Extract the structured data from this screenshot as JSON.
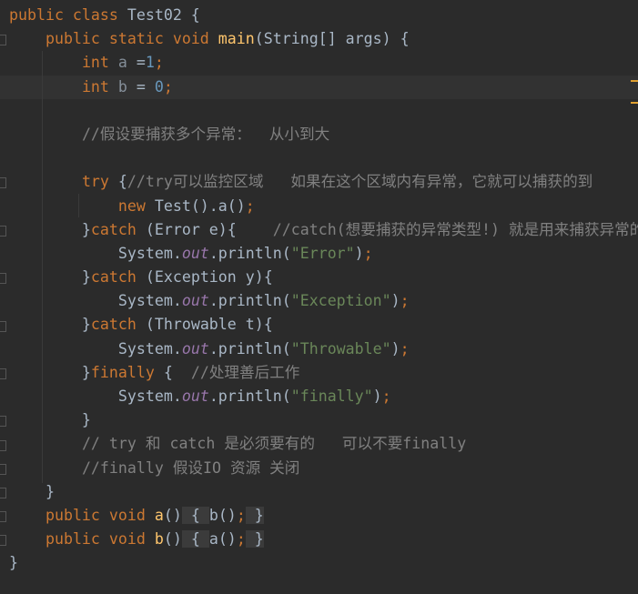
{
  "editor": {
    "current_line": 3,
    "colors": {
      "background": "#2b2b2b",
      "keyword": "#cc7832",
      "number": "#6897bb",
      "string": "#6a8759",
      "comment": "#808080",
      "method": "#ffc66d",
      "field": "#9876aa",
      "text": "#a9b7c6"
    },
    "lines": [
      {
        "tokens": [
          [
            "kw",
            "public class "
          ],
          [
            "",
            "Test02 {"
          ]
        ]
      },
      {
        "tokens": [
          [
            "",
            "    "
          ],
          [
            "kw",
            "public static void "
          ],
          [
            "fn",
            "main"
          ],
          [
            "",
            "(String[] args) {"
          ]
        ]
      },
      {
        "tokens": [
          [
            "",
            "        "
          ],
          [
            "kw",
            "int "
          ],
          [
            "var",
            "a "
          ],
          [
            "",
            "="
          ],
          [
            "num",
            "1"
          ],
          [
            "kw",
            ";"
          ]
        ]
      },
      {
        "tokens": [
          [
            "",
            "        "
          ],
          [
            "kw",
            "int "
          ],
          [
            "var",
            "b "
          ],
          [
            "",
            "= "
          ],
          [
            "num",
            "0"
          ],
          [
            "kw",
            ";"
          ]
        ]
      },
      {
        "tokens": []
      },
      {
        "tokens": [
          [
            "",
            "        "
          ],
          [
            "cm",
            "//假设要捕获多个异常：  从小到大"
          ]
        ]
      },
      {
        "tokens": []
      },
      {
        "tokens": [
          [
            "",
            "        "
          ],
          [
            "kw",
            "try "
          ],
          [
            "",
            "{"
          ],
          [
            "cm",
            "//try可以监控区域   如果在这个区域内有异常，它就可以捕获的到"
          ]
        ]
      },
      {
        "tokens": [
          [
            "",
            "            "
          ],
          [
            "kw",
            "new "
          ],
          [
            "",
            "Test().a()"
          ],
          [
            "kw",
            ";"
          ]
        ]
      },
      {
        "tokens": [
          [
            "",
            "        }"
          ],
          [
            "kw",
            "catch "
          ],
          [
            "",
            "(Error e){    "
          ],
          [
            "cm",
            "//catch(想要捕获的异常类型!) 就是用来捕获异常的"
          ]
        ]
      },
      {
        "tokens": [
          [
            "",
            "            System."
          ],
          [
            "fld",
            "out"
          ],
          [
            "",
            ".println("
          ],
          [
            "str",
            "\"Error\""
          ],
          [
            "",
            ")"
          ],
          [
            "kw",
            ";"
          ]
        ]
      },
      {
        "tokens": [
          [
            "",
            "        }"
          ],
          [
            "kw",
            "catch "
          ],
          [
            "",
            "(Exception y){"
          ]
        ]
      },
      {
        "tokens": [
          [
            "",
            "            System."
          ],
          [
            "fld",
            "out"
          ],
          [
            "",
            ".println("
          ],
          [
            "str",
            "\"Exception\""
          ],
          [
            "",
            ")"
          ],
          [
            "kw",
            ";"
          ]
        ]
      },
      {
        "tokens": [
          [
            "",
            "        }"
          ],
          [
            "kw",
            "catch "
          ],
          [
            "",
            "(Throwable t){"
          ]
        ]
      },
      {
        "tokens": [
          [
            "",
            "            System."
          ],
          [
            "fld",
            "out"
          ],
          [
            "",
            ".println("
          ],
          [
            "str",
            "\"Throwable\""
          ],
          [
            "",
            ")"
          ],
          [
            "kw",
            ";"
          ]
        ]
      },
      {
        "tokens": [
          [
            "",
            "        }"
          ],
          [
            "kw",
            "finally "
          ],
          [
            "",
            "{  "
          ],
          [
            "cm",
            "//处理善后工作"
          ]
        ]
      },
      {
        "tokens": [
          [
            "",
            "            System."
          ],
          [
            "fld",
            "out"
          ],
          [
            "",
            ".println("
          ],
          [
            "str",
            "\"finally\""
          ],
          [
            "",
            ")"
          ],
          [
            "kw",
            ";"
          ]
        ]
      },
      {
        "tokens": [
          [
            "",
            "        }"
          ]
        ]
      },
      {
        "tokens": [
          [
            "",
            "        "
          ],
          [
            "cm",
            "// try 和 catch 是必须要有的   可以不要finally"
          ]
        ]
      },
      {
        "tokens": [
          [
            "",
            "        "
          ],
          [
            "cm",
            "//finally 假设IO 资源 关闭"
          ]
        ]
      },
      {
        "tokens": [
          [
            "",
            "    }"
          ]
        ]
      },
      {
        "tokens": [
          [
            "",
            "    "
          ],
          [
            "kw",
            "public void "
          ],
          [
            "fn",
            "a"
          ],
          [
            "",
            "()"
          ],
          [
            "fold",
            " { "
          ],
          [
            "",
            "b()"
          ],
          [
            "kw",
            ";"
          ],
          [
            "fold",
            " }"
          ]
        ]
      },
      {
        "tokens": [
          [
            "",
            "    "
          ],
          [
            "kw",
            "public void "
          ],
          [
            "fn",
            "b"
          ],
          [
            "",
            "()"
          ],
          [
            "fold",
            " { "
          ],
          [
            "",
            "a()"
          ],
          [
            "kw",
            ";"
          ],
          [
            "fold",
            " }"
          ]
        ]
      },
      {
        "tokens": [
          [
            "",
            "}"
          ]
        ]
      }
    ]
  }
}
